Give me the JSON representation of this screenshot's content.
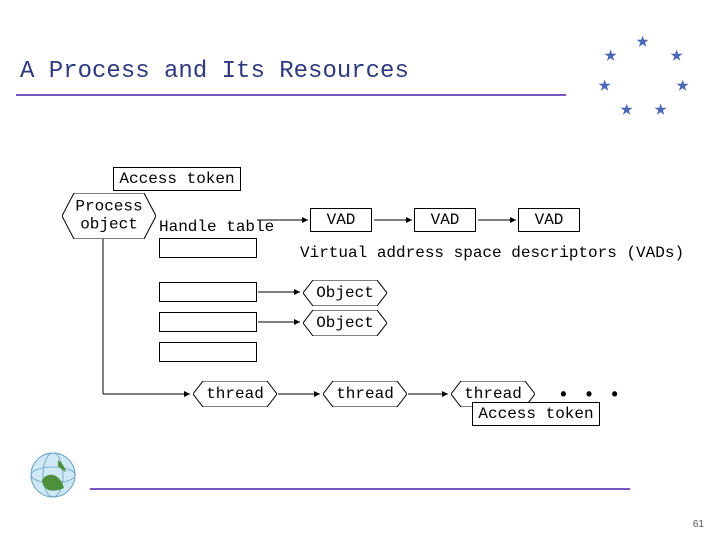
{
  "title": "A Process and Its Resources",
  "page_number": "61",
  "nodes": {
    "access_token": "Access token",
    "process_object": "Process\nobject",
    "handle_table": "Handle table",
    "vad1": "VAD",
    "vad2": "VAD",
    "vad3": "VAD",
    "vads_caption": "Virtual address space descriptors (VADs)",
    "object1": "Object",
    "object2": "Object",
    "thread1": "thread",
    "thread2": "thread",
    "thread3": "thread",
    "thread_access_token": "Access token",
    "ellipsis": "• • •"
  }
}
